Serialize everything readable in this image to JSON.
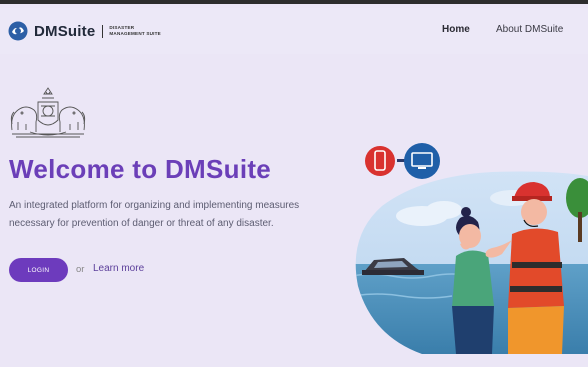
{
  "nav": {
    "brand_name": "DMSuite",
    "brand_sub_line1": "DISASTER",
    "brand_sub_line2": "MANAGEMENT SUITE",
    "links": [
      {
        "label": "Home",
        "active": true
      },
      {
        "label": "About DMSuite",
        "active": false
      }
    ]
  },
  "hero": {
    "title": "Welcome to DMSuite",
    "description_line1": "An integrated platform for organizing and implementing measures",
    "description_line2": "necessary for prevention of danger or threat of any disaster.",
    "login_label": "LOGIN",
    "or_text": "or",
    "learn_more_label": "Learn more"
  },
  "icons": {
    "brand": "globe-shield-icon",
    "emblem": "state-emblem-icon",
    "phone": "phone-icon",
    "monitor": "monitor-icon"
  },
  "colors": {
    "background": "#ebe6f6",
    "accent": "#6b3fb8",
    "button": "#6d3bbd",
    "phone_circle": "#d9322f",
    "monitor_circle": "#1f5fa8"
  }
}
